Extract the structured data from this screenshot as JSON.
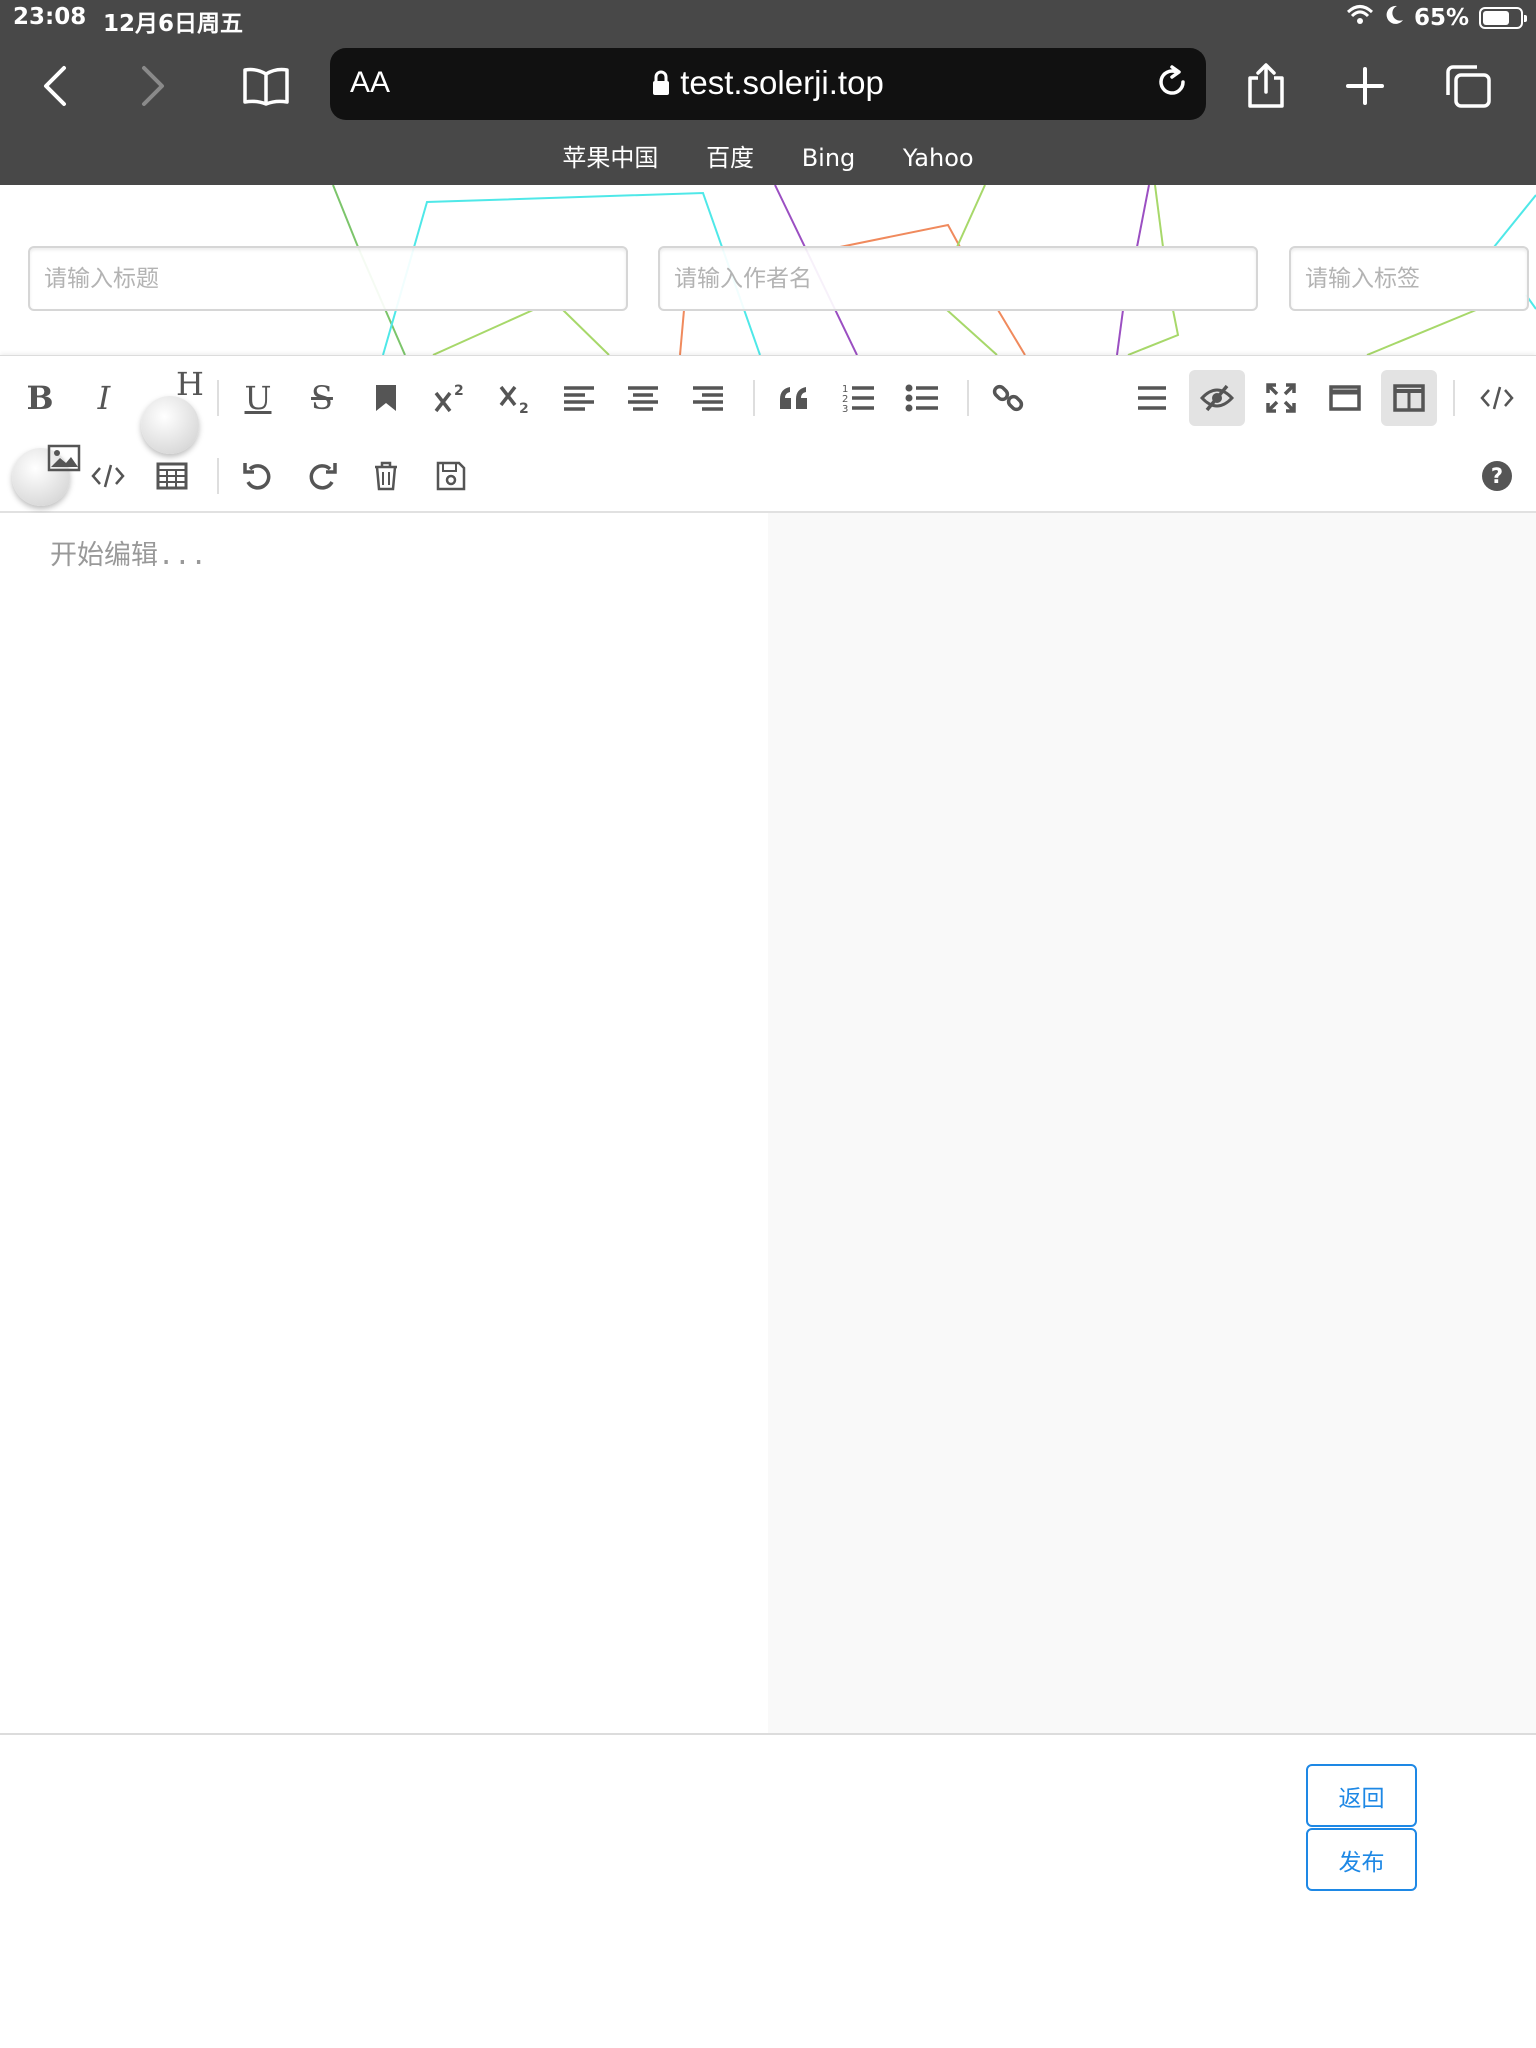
{
  "status_bar": {
    "time": "23:08",
    "date": "12月6日周五",
    "battery": "65%",
    "battery_level": 0.65
  },
  "browser": {
    "aa_label": "AA",
    "url": "test.solerji.top",
    "bookmarks": [
      "苹果中国",
      "百度",
      "Bing",
      "Yahoo"
    ]
  },
  "form": {
    "title_placeholder": "请输入标题",
    "author_placeholder": "请输入作者名",
    "tags_placeholder": "请输入标签"
  },
  "toolbar": {
    "bold": "B",
    "italic": "I",
    "heading": "H",
    "underline": "U",
    "strike": "S"
  },
  "editor": {
    "placeholder": "开始编辑..."
  },
  "actions": {
    "back_label": "返回",
    "publish_label": "发布"
  },
  "colors": {
    "accent": "#1e88e5",
    "chrome": "#484848",
    "urlbar": "#111111",
    "preview_bg": "#f9f9f9"
  }
}
